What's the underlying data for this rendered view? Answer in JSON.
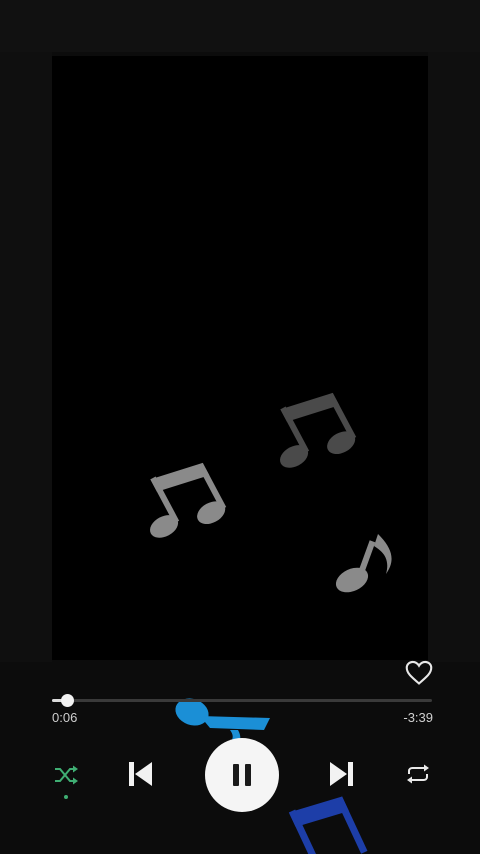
{
  "player": {
    "elapsed": "0:06",
    "remaining": "-3:39",
    "progress_fraction": 0.04,
    "liked": false,
    "shuffle_on": true,
    "state": "playing"
  },
  "icons": {
    "like": "heart-outline-icon",
    "shuffle": "shuffle-icon",
    "previous": "skip-previous-icon",
    "play_pause": "pause-icon",
    "next": "skip-next-icon",
    "repeat": "repeat-icon"
  },
  "colors": {
    "background": "#0c0c0c",
    "video": "#000000",
    "accent_shuffle": "#3fae73",
    "note_gray": "#8a8a8a",
    "note_blue": "#1b8fd6",
    "note_navy": "#1d3ea8"
  }
}
